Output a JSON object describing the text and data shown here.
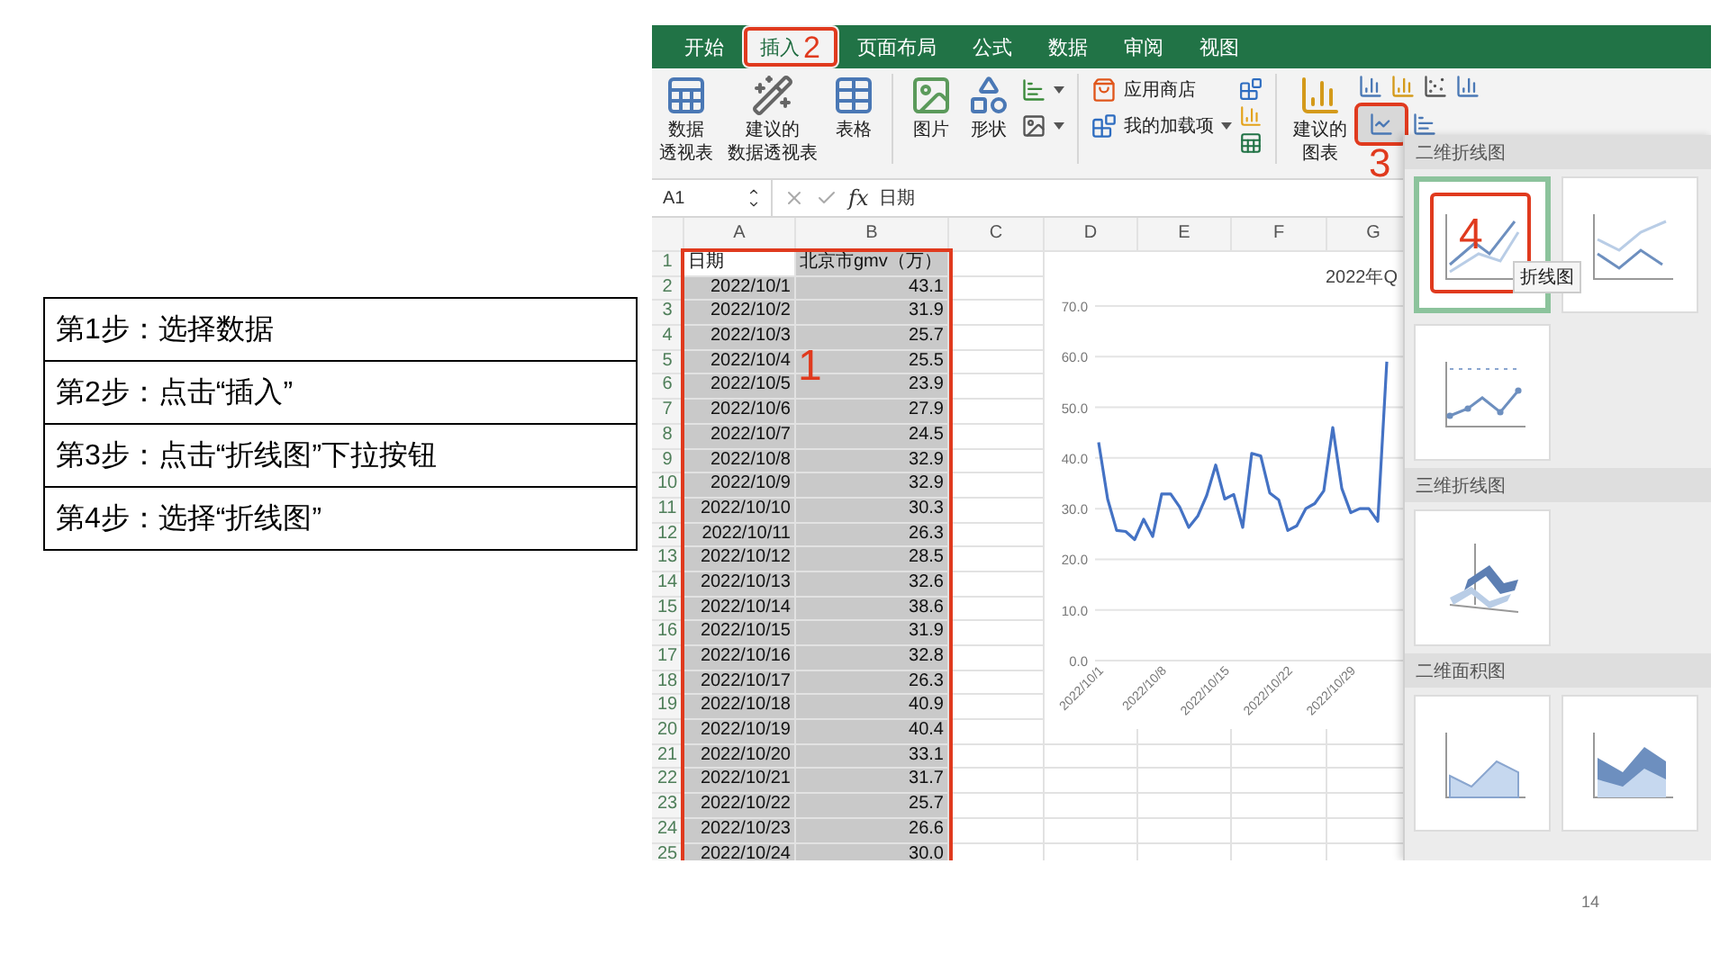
{
  "steps": [
    "第1步：选择数据",
    "第2步：点击“插入”",
    "第3步：点击“折线图”下拉按钮",
    "第4步：选择“折线图”"
  ],
  "excel": {
    "tabs": [
      {
        "label": "开始",
        "selected": false
      },
      {
        "label": "插入",
        "selected": true,
        "marker": "2"
      },
      {
        "label": "页面布局",
        "selected": false
      },
      {
        "label": "公式",
        "selected": false
      },
      {
        "label": "数据",
        "selected": false
      },
      {
        "label": "审阅",
        "selected": false
      },
      {
        "label": "视图",
        "selected": false
      }
    ],
    "ribbon": {
      "pivot": [
        "数据",
        "透视表"
      ],
      "suggested_pivot": [
        "建议的",
        "数据透视表"
      ],
      "table": "表格",
      "pictures": "图片",
      "shapes": "形状",
      "store": "应用商店",
      "addins": "我的加载项",
      "suggested_charts": [
        "建议的",
        "图表"
      ],
      "line_button_marker": "3"
    },
    "name_box": "A1",
    "function_label": "fx",
    "formula": "日期",
    "columns": [
      "A",
      "B",
      "C",
      "D",
      "E",
      "F",
      "G"
    ],
    "rows": [
      {
        "num": "1",
        "kind": "header",
        "a": "日期",
        "b": "北京市gmv（万）",
        "selected": true
      },
      {
        "num": "2",
        "kind": "data",
        "a": "2022/10/1",
        "b": "43.1",
        "selected": true
      },
      {
        "num": "3",
        "kind": "data",
        "a": "2022/10/2",
        "b": "31.9",
        "selected": true
      },
      {
        "num": "4",
        "kind": "data",
        "a": "2022/10/3",
        "b": "25.7",
        "selected": true
      },
      {
        "num": "5",
        "kind": "data",
        "a": "2022/10/4",
        "b": "25.5",
        "selected": true
      },
      {
        "num": "6",
        "kind": "data",
        "a": "2022/10/5",
        "b": "23.9",
        "selected": true
      },
      {
        "num": "7",
        "kind": "data",
        "a": "2022/10/6",
        "b": "27.9",
        "selected": true
      },
      {
        "num": "8",
        "kind": "data",
        "a": "2022/10/7",
        "b": "24.5",
        "selected": true
      },
      {
        "num": "9",
        "kind": "data",
        "a": "2022/10/8",
        "b": "32.9",
        "selected": true
      },
      {
        "num": "10",
        "kind": "data",
        "a": "2022/10/9",
        "b": "32.9",
        "selected": true
      },
      {
        "num": "11",
        "kind": "data",
        "a": "2022/10/10",
        "b": "30.3",
        "selected": true
      },
      {
        "num": "12",
        "kind": "data",
        "a": "2022/10/11",
        "b": "26.3",
        "selected": true
      },
      {
        "num": "13",
        "kind": "data",
        "a": "2022/10/12",
        "b": "28.5",
        "selected": true
      },
      {
        "num": "14",
        "kind": "data",
        "a": "2022/10/13",
        "b": "32.6",
        "selected": true
      },
      {
        "num": "15",
        "kind": "data",
        "a": "2022/10/14",
        "b": "38.6",
        "selected": true
      },
      {
        "num": "16",
        "kind": "data",
        "a": "2022/10/15",
        "b": "31.9",
        "selected": true
      },
      {
        "num": "17",
        "kind": "data",
        "a": "2022/10/16",
        "b": "32.8",
        "selected": true
      },
      {
        "num": "18",
        "kind": "data",
        "a": "2022/10/17",
        "b": "26.3",
        "selected": true
      },
      {
        "num": "19",
        "kind": "data",
        "a": "2022/10/18",
        "b": "40.9",
        "selected": true
      },
      {
        "num": "20",
        "kind": "data",
        "a": "2022/10/19",
        "b": "40.4",
        "selected": true
      },
      {
        "num": "21",
        "kind": "data",
        "a": "2022/10/20",
        "b": "33.1",
        "selected": true
      },
      {
        "num": "22",
        "kind": "data",
        "a": "2022/10/21",
        "b": "31.7",
        "selected": true
      },
      {
        "num": "23",
        "kind": "data",
        "a": "2022/10/22",
        "b": "25.7",
        "selected": true
      },
      {
        "num": "24",
        "kind": "data",
        "a": "2022/10/23",
        "b": "26.6",
        "selected": true
      },
      {
        "num": "25",
        "kind": "data",
        "a": "2022/10/24",
        "b": "30.0",
        "selected": true
      }
    ],
    "selection_marker": "1",
    "chart_data": {
      "type": "line",
      "title": "2022年Q",
      "categories": [
        "2022/10/1",
        null,
        null,
        null,
        null,
        null,
        null,
        "2022/10/8",
        null,
        null,
        null,
        null,
        null,
        null,
        "2022/10/15",
        null,
        null,
        null,
        null,
        null,
        null,
        "2022/10/22",
        null,
        null,
        null,
        null,
        null,
        null,
        "2022/10/29",
        null,
        null,
        null,
        null
      ],
      "series": [
        {
          "color": "#4472c4",
          "values": [
            43.1,
            31.9,
            25.7,
            25.5,
            23.9,
            27.9,
            24.5,
            32.9,
            32.9,
            30.3,
            26.3,
            28.5,
            32.6,
            38.6,
            31.9,
            32.8,
            26.3,
            40.9,
            40.4,
            33.1,
            31.7,
            25.7,
            26.6,
            30.0,
            31.0,
            33.5,
            46.0,
            34.0,
            29.2,
            30.0,
            30.0,
            27.5,
            59.0
          ]
        }
      ],
      "ylim": [
        0,
        70
      ],
      "grid": true,
      "yticks": [
        {
          "value": 0,
          "label": "0.0"
        },
        {
          "value": 10,
          "label": "10.0"
        },
        {
          "value": 20,
          "label": "20.0"
        },
        {
          "value": 30,
          "label": "30.0"
        },
        {
          "value": 40,
          "label": "40.0"
        },
        {
          "value": 50,
          "label": "50.0"
        },
        {
          "value": 60,
          "label": "60.0"
        },
        {
          "value": 70,
          "label": "70.0"
        }
      ]
    },
    "gallery": [
      {
        "title": "二维折线图",
        "items": [
          {
            "kind": "line",
            "selected": true,
            "marker": "4",
            "tooltip": "折线图"
          },
          {
            "kind": "stacked",
            "selected": false
          },
          {
            "kind": "markers",
            "selected": false
          }
        ]
      },
      {
        "title": "三维折线图",
        "items": [
          {
            "kind": "line3d",
            "selected": false
          }
        ]
      },
      {
        "title": "二维面积图",
        "items": [
          {
            "kind": "area",
            "selected": false
          },
          {
            "kind": "stackedarea",
            "selected": false
          }
        ]
      }
    ]
  },
  "page_number": "14"
}
